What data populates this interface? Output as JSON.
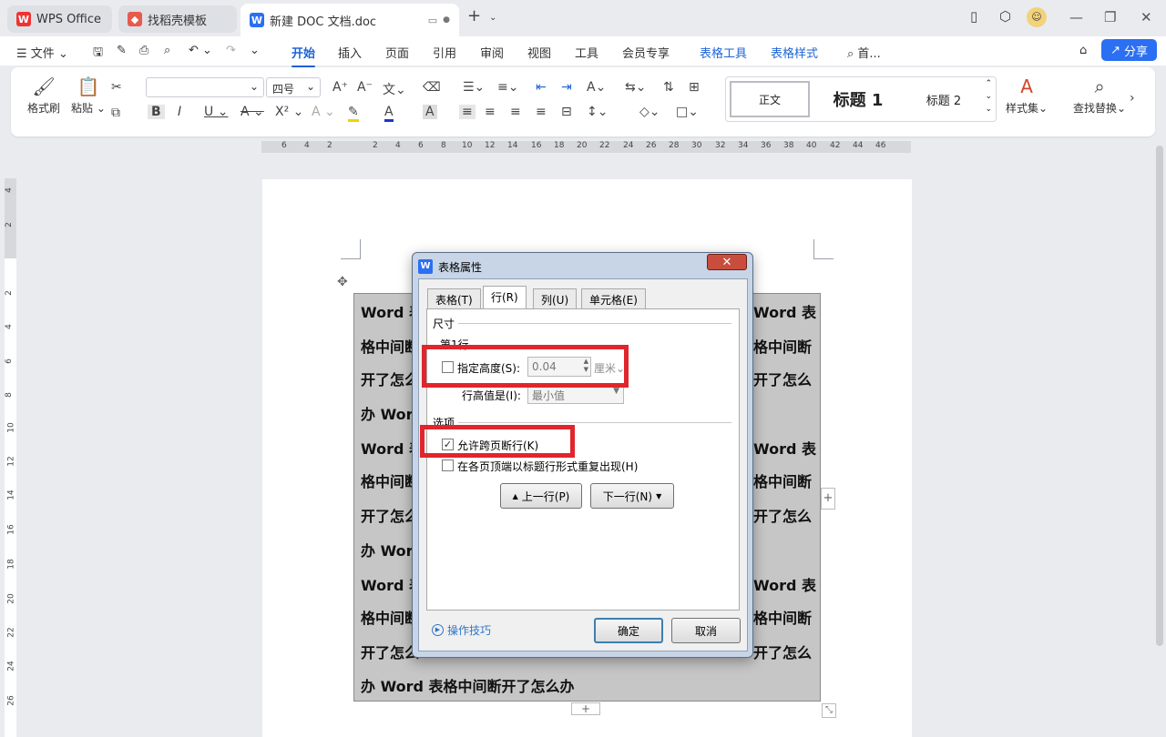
{
  "tabs": [
    {
      "label": "WPS Office",
      "icon": "wps-logo-icon"
    },
    {
      "label": "找稻壳模板",
      "icon": "docer-logo-icon"
    },
    {
      "label": "新建 DOC 文档.doc",
      "icon": "word-doc-icon"
    }
  ],
  "menubar": {
    "file": "文件",
    "items": [
      "开始",
      "插入",
      "页面",
      "引用",
      "审阅",
      "视图",
      "工具",
      "会员专享",
      "表格工具",
      "表格样式"
    ],
    "active": "开始",
    "search": "首...",
    "share": "分享"
  },
  "ribbon": {
    "format_painter": "格式刷",
    "paste": "粘贴",
    "font_name": "",
    "font_size": "四号",
    "styles": [
      "正文",
      "标题 1",
      "标题 2"
    ],
    "style_set": "样式集",
    "find_replace": "查找替换"
  },
  "hruler_ticks": [
    "6",
    "4",
    "2",
    "2",
    "4",
    "6",
    "8",
    "10",
    "12",
    "14",
    "16",
    "18",
    "20",
    "22",
    "24",
    "26",
    "28",
    "30",
    "32",
    "34",
    "36",
    "38",
    "40",
    "42",
    "44",
    "46"
  ],
  "vruler_ticks": [
    "4",
    "2",
    "2",
    "4",
    "6",
    "8",
    "10",
    "12",
    "14",
    "16",
    "18",
    "20",
    "22",
    "24",
    "26"
  ],
  "document": {
    "lines_left": [
      "Word 表",
      "格中间断",
      "开了怎么",
      "办 Word",
      "Word 表",
      "格中间断",
      "开了怎么",
      "办 Word",
      "Word 表",
      "格中间断",
      "开了怎么"
    ],
    "lines_right": [
      "Word 表",
      "格中间断",
      "开了怎么",
      "",
      "Word 表",
      "格中间断",
      "开了怎么",
      "",
      "Word 表",
      "格中间断",
      "开了怎么"
    ],
    "last_line": "办 Word 表格中间断开了怎么办"
  },
  "dialog": {
    "title": "表格属性",
    "close": "✕",
    "tabs": [
      "表格(T)",
      "行(R)",
      "列(U)",
      "单元格(E)"
    ],
    "active_tab": "行(R)",
    "size_group": "尺寸",
    "row_label": "第1行",
    "specify_height": "指定高度(S):",
    "height_value": "0.04",
    "unit": "厘米",
    "row_height_is": "行高值是(I):",
    "row_height_mode": "最小值",
    "options_group": "选项",
    "allow_break": "允许跨页断行(K)",
    "allow_break_checked": true,
    "repeat_header": "在各页顶端以标题行形式重复出现(H)",
    "repeat_header_checked": false,
    "prev_row": "上一行(P)",
    "next_row": "下一行(N)",
    "tips": "操作技巧",
    "ok": "确定",
    "cancel": "取消"
  },
  "colors": {
    "accent": "#1e63d6",
    "share": "#2b6ff2",
    "highlight_box": "#e0262c",
    "dialog_frame": "#c7d5e6",
    "table_fill": "#c6c6c6"
  }
}
